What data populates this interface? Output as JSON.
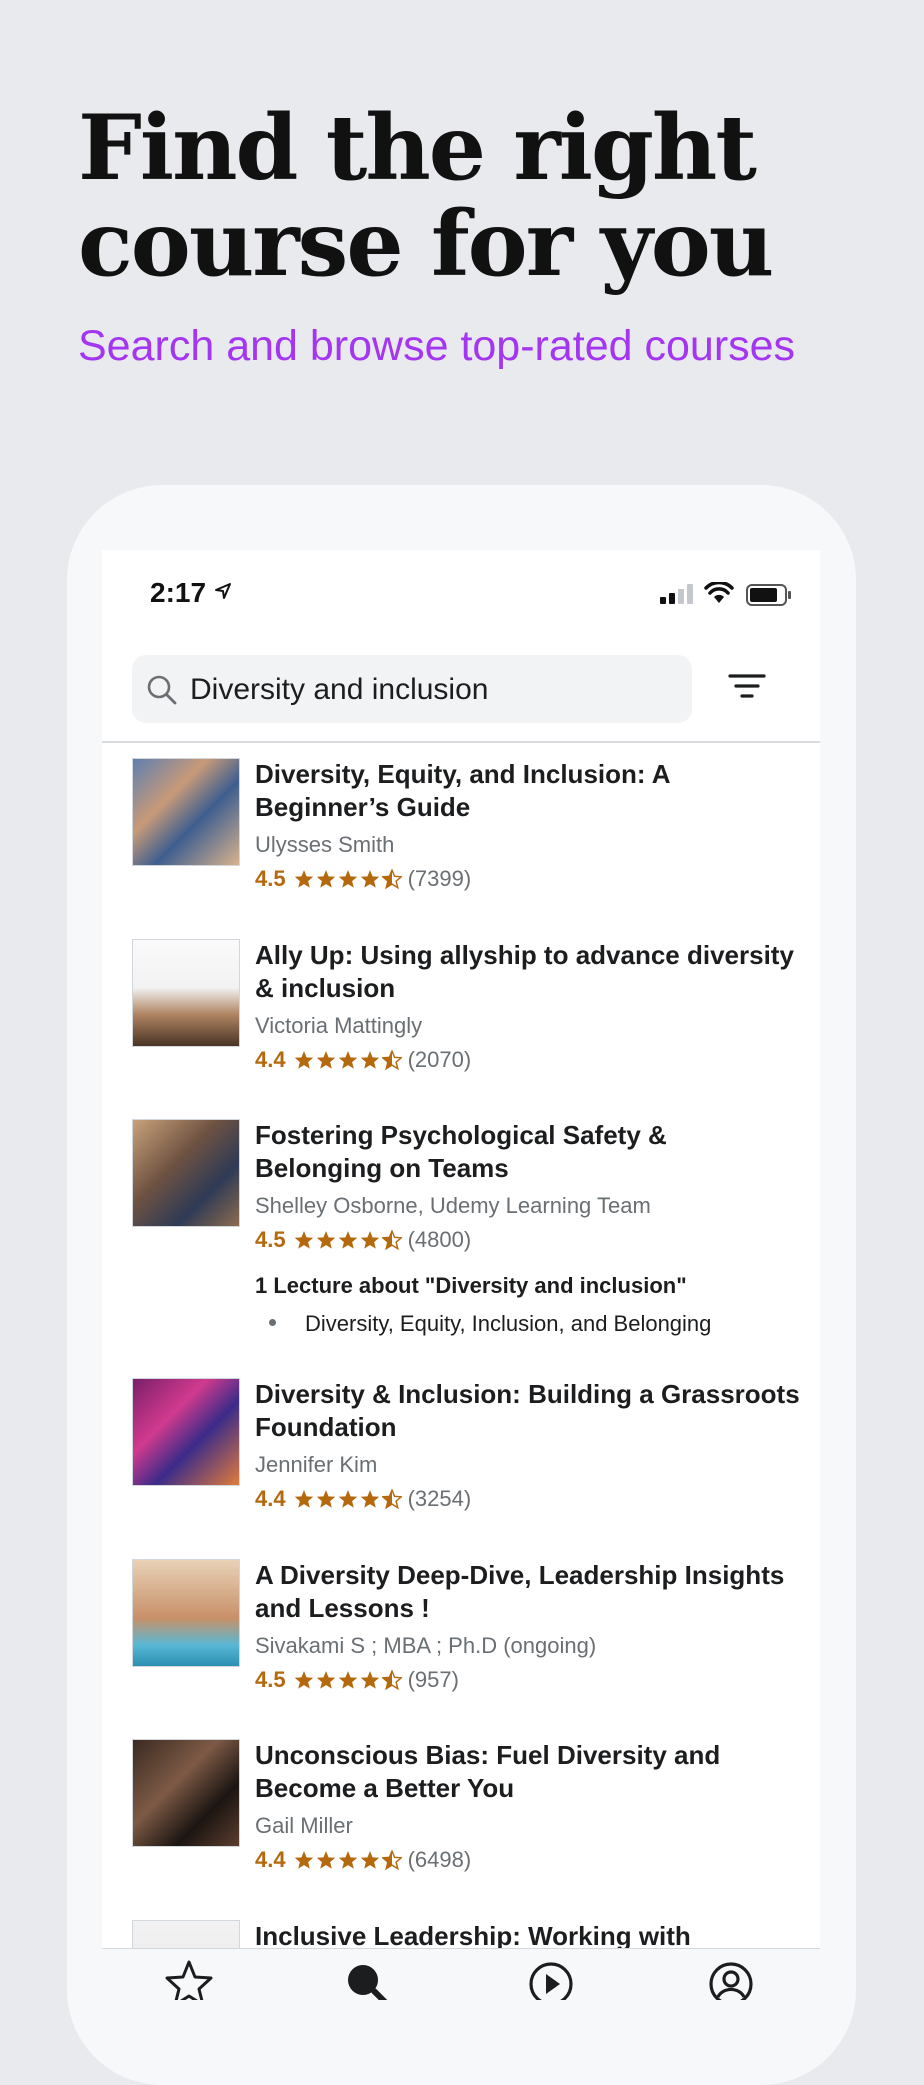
{
  "hero": {
    "title": "Find the right course for you",
    "subtitle": "Search and browse top-rated courses"
  },
  "status_bar": {
    "time": "2:17"
  },
  "search": {
    "query": "Diversity and inclusion",
    "icon": "search-icon",
    "filter_icon": "filter-icon"
  },
  "colors": {
    "accent": "#a435f0",
    "rating": "#b4690e",
    "text": "#1c1d1f",
    "muted": "#6a6f73"
  },
  "courses": [
    {
      "title": "Diversity, Equity, and Inclusion: A Beginner’s Guide",
      "author": "Ulysses Smith",
      "rating": "4.5",
      "stars": 4.5,
      "reviews": "(7399)"
    },
    {
      "title": "Ally Up: Using allyship to advance diversity & inclusion",
      "author": "Victoria Mattingly",
      "rating": "4.4",
      "stars": 4.5,
      "reviews": "(2070)"
    },
    {
      "title": "Fostering Psychological Safety & Belonging on Teams",
      "author": "Shelley Osborne, Udemy Learning Team",
      "rating": "4.5",
      "stars": 4.5,
      "reviews": "(4800)",
      "lectures_heading": "1 Lecture about \"Diversity and inclusion\"",
      "lecture": "Diversity, Equity, Inclusion, and Belonging"
    },
    {
      "title": "Diversity & Inclusion: Building a Grassroots Foundation",
      "author": "Jennifer Kim",
      "rating": "4.4",
      "stars": 4.5,
      "reviews": "(3254)"
    },
    {
      "title": "A Diversity Deep-Dive, Leadership Insights and Lessons !",
      "author": "Sivakami S ; MBA ; Ph.D (ongoing)",
      "rating": "4.5",
      "stars": 4.5,
      "reviews": "(957)"
    },
    {
      "title": "Unconscious Bias: Fuel Diversity and Become a Better You",
      "author": "Gail Miller",
      "rating": "4.4",
      "stars": 4.5,
      "reviews": "(6498)"
    },
    {
      "title": "Inclusive Leadership: Working with"
    }
  ],
  "tabs": [
    {
      "icon": "star-icon",
      "name": "featured"
    },
    {
      "icon": "search-icon",
      "name": "search"
    },
    {
      "icon": "play-icon",
      "name": "my-learning"
    },
    {
      "icon": "account-icon",
      "name": "account"
    }
  ]
}
